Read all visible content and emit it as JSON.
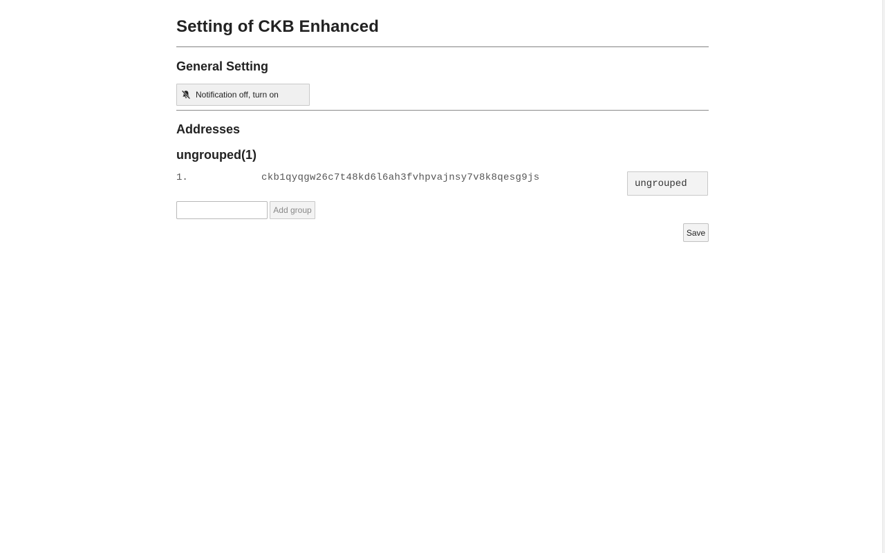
{
  "page": {
    "title": "Setting of CKB Enhanced"
  },
  "general": {
    "heading": "General Setting",
    "notification_button_label": "Notification off, turn on",
    "notification_icon": "bell-off-icon"
  },
  "addresses": {
    "heading": "Addresses",
    "groups": [
      {
        "title": "ungrouped(1)",
        "items": [
          {
            "index": "1.",
            "address": "ckb1qyqgw26c7t48kd6l6ah3fvhpvajnsy7v8k8qesg9js",
            "group": "ungrouped"
          }
        ]
      }
    ]
  },
  "add_group": {
    "input_value": "",
    "button_label": "Add group"
  },
  "actions": {
    "save_label": "Save"
  }
}
